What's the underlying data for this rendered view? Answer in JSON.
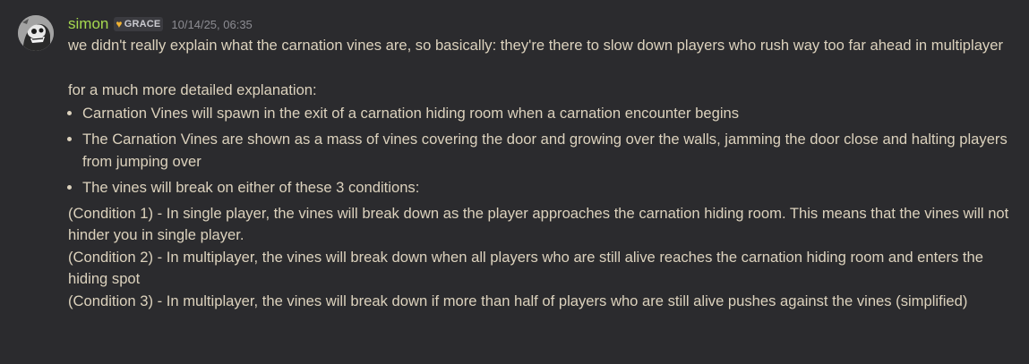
{
  "author": {
    "username": "simon",
    "tag": "GRACE",
    "tag_icon": "heart-icon",
    "timestamp": "10/14/25, 06:35"
  },
  "colors": {
    "background": "#2b2b2e",
    "username": "#a6d94f",
    "text": "#dcd2bd",
    "timestamp": "#8c8c92",
    "tag_heart": "#f0b232"
  },
  "message": {
    "intro": "we didn't really explain what the carnation vines are, so basically: they're there to slow down players who rush way too far ahead in multiplayer",
    "detail_heading": "for a much more detailed explanation:",
    "bullets": [
      "Carnation Vines will spawn in the exit of a carnation hiding room when a carnation encounter begins",
      "The Carnation Vines are shown as a mass of vines covering the door and growing over the walls, jamming the door close and halting players from jumping over",
      "The vines will break on either of these 3 conditions:"
    ],
    "conditions": [
      "(Condition 1) - In single player, the vines will break down as the player approaches the carnation hiding room. This means that the vines will not hinder you in single player.",
      "(Condition 2) - In multiplayer, the vines will break down when all players who are still alive reaches the carnation hiding room and enters the hiding spot",
      "(Condition 3) - In multiplayer, the vines will break down if more than half of players who are still alive pushes against the vines (simplified)"
    ]
  }
}
